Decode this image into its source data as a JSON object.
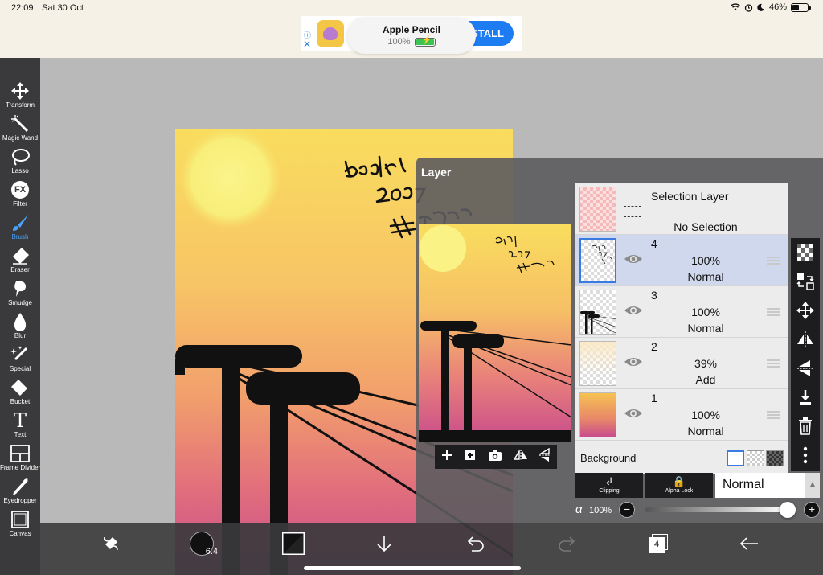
{
  "statusbar": {
    "time": "22:09",
    "date": "Sat 30 Oct",
    "battery": "46%"
  },
  "ad": {
    "product_title": "Apple Pencil",
    "product_battery": "100%",
    "cta": "STALL",
    "info_icon": "info-icon",
    "close_icon": "close-icon"
  },
  "toolbar": {
    "tools": [
      {
        "label": "Transform",
        "icon": "move-arrows-icon"
      },
      {
        "label": "Magic Wand",
        "icon": "magic-wand-icon"
      },
      {
        "label": "Lasso",
        "icon": "lasso-icon"
      },
      {
        "label": "Filter",
        "icon": "fx-icon"
      },
      {
        "label": "Brush",
        "icon": "brush-icon",
        "active": true
      },
      {
        "label": "Eraser",
        "icon": "eraser-icon"
      },
      {
        "label": "Smudge",
        "icon": "smudge-icon"
      },
      {
        "label": "Blur",
        "icon": "drop-icon"
      },
      {
        "label": "Special",
        "icon": "sparkle-icon"
      },
      {
        "label": "Bucket",
        "icon": "bucket-icon"
      },
      {
        "label": "Text",
        "icon": "text-icon"
      },
      {
        "label": "Frame Divider",
        "icon": "frame-divider-icon"
      },
      {
        "label": "Eyedropper",
        "icon": "eyedropper-icon"
      },
      {
        "label": "Canvas",
        "icon": "canvas-icon"
      }
    ],
    "fx_glyph": "FX",
    "text_glyph": "T"
  },
  "artwork": {
    "handwriting": [
      "badri",
      "2001",
      "#HEAVEN"
    ]
  },
  "layer_panel": {
    "title": "Layer",
    "selection_layer": {
      "title": "Selection Layer",
      "status": "No Selection"
    },
    "layers": [
      {
        "number": "4",
        "opacity": "100%",
        "blend": "Normal",
        "selected": true
      },
      {
        "number": "3",
        "opacity": "100%",
        "blend": "Normal",
        "selected": false
      },
      {
        "number": "2",
        "opacity": "39%",
        "blend": "Add",
        "selected": false
      },
      {
        "number": "1",
        "opacity": "100%",
        "blend": "Normal",
        "selected": false
      }
    ],
    "background_label": "Background",
    "clipping_label": "Clipping",
    "alpha_lock_label": "Alpha Lock",
    "blend_mode": "Normal",
    "alpha_symbol": "α",
    "alpha_value": "100%",
    "minus": "−",
    "plus": "+"
  },
  "bottombar": {
    "brush_size": "6.4",
    "layer_count": "4"
  },
  "colors": {
    "accent": "#4aa3ff",
    "selected_row": "#cfd8ec",
    "panel": "#5c5c5f"
  }
}
